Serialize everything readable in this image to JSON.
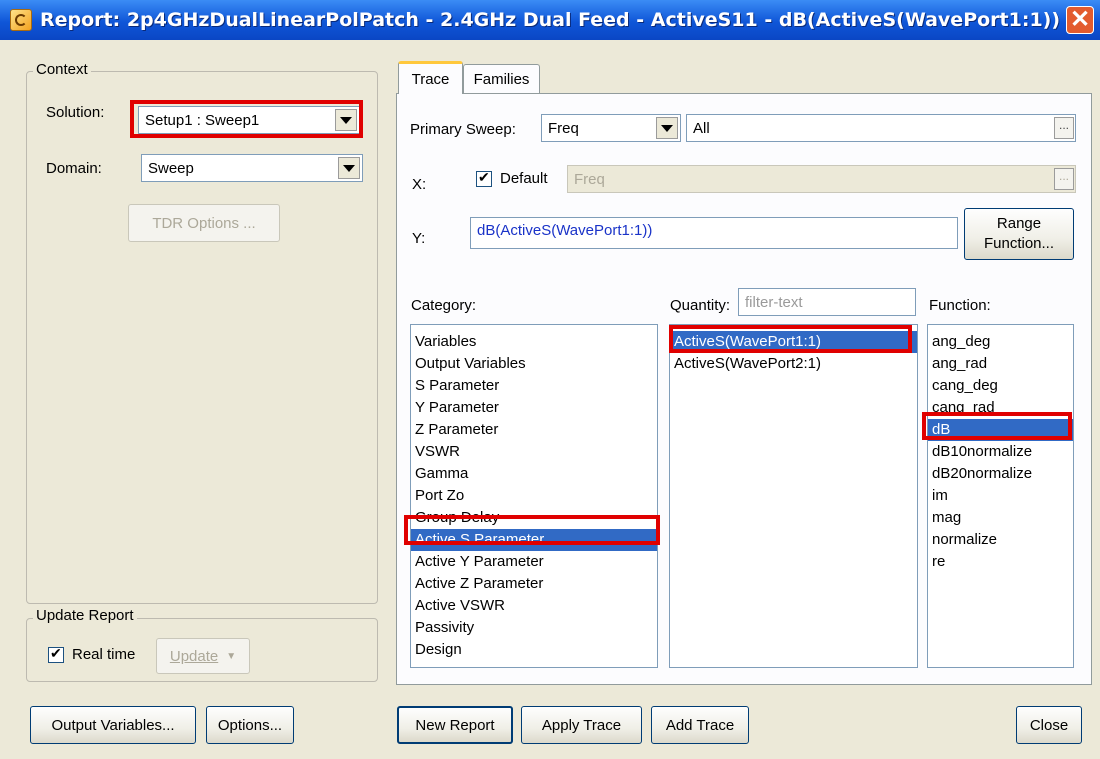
{
  "title": "Report: 2p4GHzDualLinearPolPatch - 2.4GHz Dual Feed - ActiveS11 - dB(ActiveS(WavePort1:1))",
  "context": {
    "legend": "Context",
    "solution_label": "Solution:",
    "solution_value": "Setup1 : Sweep1",
    "domain_label": "Domain:",
    "domain_value": "Sweep",
    "tdr_button": "TDR Options ..."
  },
  "update": {
    "legend": "Update Report",
    "realtime_label": "Real time",
    "update_button": "Update"
  },
  "tabs": [
    "Trace",
    "Families"
  ],
  "trace": {
    "primary_sweep_label": "Primary Sweep:",
    "primary_sweep_value": "Freq",
    "primary_sweep_range": "All",
    "x_label": "X:",
    "default_label": "Default",
    "x_value": "Freq",
    "y_label": "Y:",
    "y_value": "dB(ActiveS(WavePort1:1))",
    "range_function_line1": "Range",
    "range_function_line2": "Function...",
    "category_label": "Category:",
    "quantity_label": "Quantity:",
    "quantity_filter_placeholder": "filter-text",
    "function_label": "Function:",
    "categories": [
      "Variables",
      "Output Variables",
      "S Parameter",
      "Y Parameter",
      "Z Parameter",
      "VSWR",
      "Gamma",
      "Port Zo",
      "Group Delay",
      "Active S Parameter",
      "Active Y Parameter",
      "Active Z Parameter",
      "Active VSWR",
      "Passivity",
      "Design"
    ],
    "selected_category": "Active S Parameter",
    "quantities": [
      "ActiveS(WavePort1:1)",
      "ActiveS(WavePort2:1)"
    ],
    "selected_quantity": "ActiveS(WavePort1:1)",
    "functions": [
      "ang_deg",
      "ang_rad",
      "cang_deg",
      "cang_rad",
      "dB",
      "dB10normalize",
      "dB20normalize",
      "im",
      "mag",
      "normalize",
      "re"
    ],
    "selected_function": "dB"
  },
  "buttons": {
    "output_variables": "Output Variables...",
    "options": "Options...",
    "new_report": "New Report",
    "apply_trace": "Apply Trace",
    "add_trace": "Add Trace",
    "close": "Close"
  },
  "colors": {
    "highlight_border": "#e00000",
    "selection": "#316ac5",
    "title_bar": "#0f56d8"
  }
}
